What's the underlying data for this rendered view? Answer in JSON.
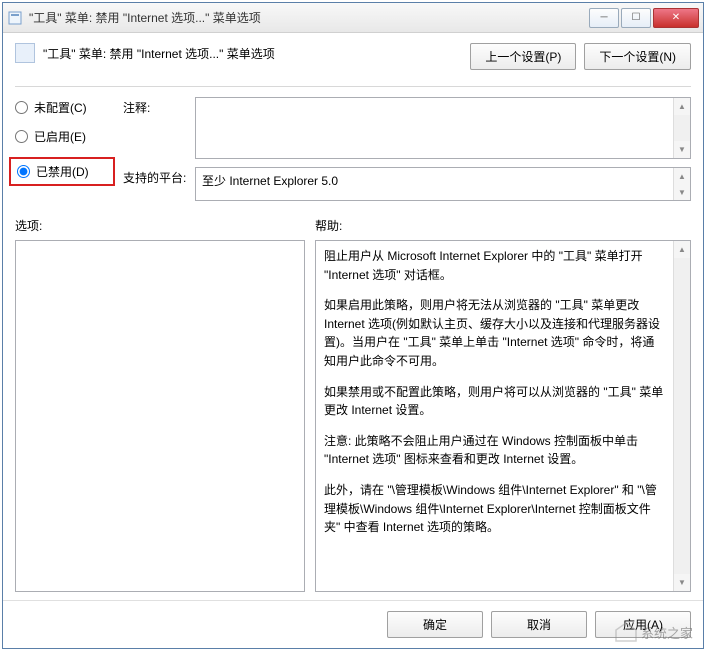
{
  "window": {
    "title": "\"工具\" 菜单: 禁用 \"Internet 选项...\" 菜单选项"
  },
  "header": {
    "title": "\"工具\" 菜单: 禁用 \"Internet 选项...\" 菜单选项",
    "prev_button": "上一个设置(P)",
    "next_button": "下一个设置(N)"
  },
  "radios": {
    "not_configured": "未配置(C)",
    "enabled": "已启用(E)",
    "disabled": "已禁用(D)"
  },
  "fields": {
    "comment_label": "注释:",
    "comment_value": "",
    "platform_label": "支持的平台:",
    "platform_value": "至少 Internet Explorer 5.0"
  },
  "panels": {
    "options_label": "选项:",
    "help_label": "帮助:"
  },
  "help": {
    "p1": "阻止用户从 Microsoft Internet Explorer 中的 \"工具\" 菜单打开 \"Internet 选项\" 对话框。",
    "p2": "如果启用此策略，则用户将无法从浏览器的 \"工具\" 菜单更改 Internet 选项(例如默认主页、缓存大小以及连接和代理服务器设置)。当用户在 \"工具\" 菜单上单击 \"Internet 选项\" 命令时，将通知用户此命令不可用。",
    "p3": "如果禁用或不配置此策略，则用户将可以从浏览器的 \"工具\" 菜单更改 Internet 设置。",
    "p4": "注意: 此策略不会阻止用户通过在 Windows 控制面板中单击 \"Internet 选项\" 图标来查看和更改 Internet 设置。",
    "p5": "此外，请在 \"\\管理模板\\Windows 组件\\Internet Explorer\" 和 \"\\管理模板\\Windows 组件\\Internet Explorer\\Internet 控制面板文件夹\" 中查看 Internet 选项的策略。"
  },
  "footer": {
    "ok": "确定",
    "cancel": "取消",
    "apply": "应用(A)"
  },
  "watermark": {
    "text": "系统之家"
  }
}
